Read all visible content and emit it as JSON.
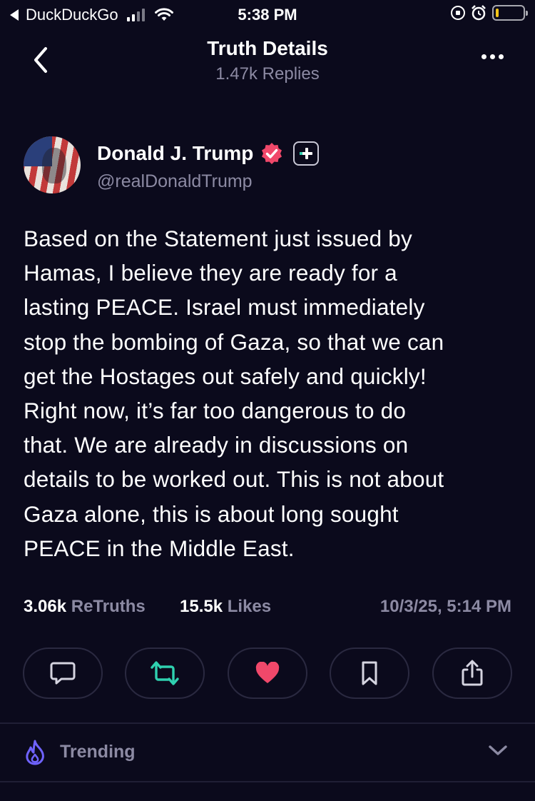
{
  "status_bar": {
    "carrier": "DuckDuckGo",
    "time": "5:38 PM"
  },
  "header": {
    "title": "Truth Details",
    "subtitle": "1.47k Replies"
  },
  "post": {
    "display_name": "Donald J. Trump",
    "handle": "@realDonaldTrump",
    "text": "Based on the Statement just issued by\nHamas, I believe they are ready for a\nlasting PEACE. Israel must immediately\nstop the bombing of Gaza, so that we can\nget the Hostages out safely and quickly!\nRight now, it’s far too dangerous to do\nthat. We are already in discussions on\ndetails to be worked out. This is not about\nGaza alone, this is about long sought\nPEACE in the Middle East.",
    "retruths_count": "3.06k",
    "retruths_label": "ReTruths",
    "likes_count": "15.5k",
    "likes_label": "Likes",
    "timestamp": "10/3/25, 5:14 PM"
  },
  "actions": [
    {
      "icon": "comment-icon"
    },
    {
      "icon": "retruth-icon",
      "color": "#2fd1b0"
    },
    {
      "icon": "heart-icon",
      "color": "#f0486a"
    },
    {
      "icon": "bookmark-icon"
    },
    {
      "icon": "share-icon"
    }
  ],
  "trending": {
    "label": "Trending",
    "icon": "flame-icon",
    "icon_color": "#6f63ff"
  },
  "colors": {
    "background": "#0b0a1c",
    "muted_text": "#8c8aa3",
    "verified_badge": "#f0486a",
    "battery": "#f5c518"
  }
}
